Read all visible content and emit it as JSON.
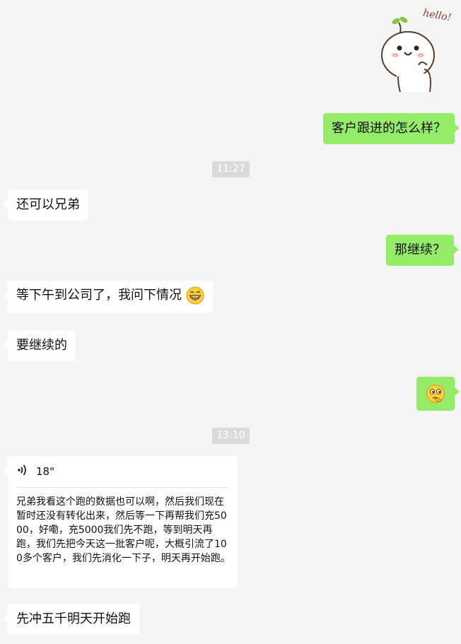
{
  "sticker": {
    "text": "hello!"
  },
  "messages": [
    {
      "id": "m1",
      "side": "out",
      "text": "客户跟进的怎么样？"
    },
    {
      "id": "t1",
      "type": "time",
      "text": "11:27"
    },
    {
      "id": "m2",
      "side": "in",
      "text": "还可以兄弟"
    },
    {
      "id": "m3",
      "side": "out",
      "text": "那继续？"
    },
    {
      "id": "m4",
      "side": "in",
      "text": "等下午到公司了，我问下情况",
      "emoji": "grin-emoji"
    },
    {
      "id": "m5",
      "side": "in",
      "text": "要继续的"
    },
    {
      "id": "m6",
      "side": "out",
      "emoji": "thinking-emoji"
    },
    {
      "id": "t2",
      "type": "time",
      "text": "13:10"
    },
    {
      "id": "m7",
      "side": "in",
      "type": "voice",
      "duration": "18\"",
      "transcript": "兄弟我看这个跑的数据也可以啊，然后我们现在暂时还没有转化出来，然后等一下再帮我们充5000，好嘞，充5000我们先不跑，等到明天再跑，我们先把今天这一批客户呢，大概引流了100多个客户，我们先消化一下子，明天再开始跑。"
    },
    {
      "id": "m8",
      "side": "in",
      "text": "先冲五千明天开始跑"
    }
  ]
}
